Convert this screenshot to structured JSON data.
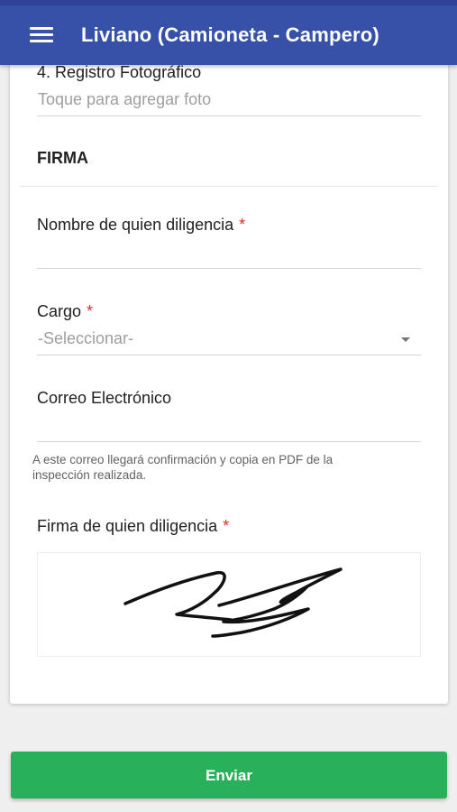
{
  "app_bar": {
    "title": "Liviano (Camioneta - Campero)",
    "menu_icon": "hamburger-menu-icon",
    "color": "#3751a8"
  },
  "photo_section": {
    "label": "4. Registro Fotográfico",
    "placeholder": "Toque para agregar foto"
  },
  "signature_section": {
    "title": "FIRMA",
    "name_field": {
      "label": "Nombre de quien diligencia",
      "required_mark": "*",
      "value": ""
    },
    "role_field": {
      "label": "Cargo",
      "required_mark": "*",
      "selected": "-Seleccionar-"
    },
    "email_field": {
      "label": "Correo Electrónico",
      "value": "",
      "helper": "A este correo llegará confirmación y copia en PDF de la inspección realizada."
    },
    "signature_field": {
      "label": "Firma de quien diligencia",
      "required_mark": "*"
    }
  },
  "submit_button": {
    "label": "Enviar",
    "color": "#29b05a"
  },
  "colors": {
    "required": "#d32f2f",
    "placeholder": "#9e9e9e",
    "background": "#efefef"
  }
}
